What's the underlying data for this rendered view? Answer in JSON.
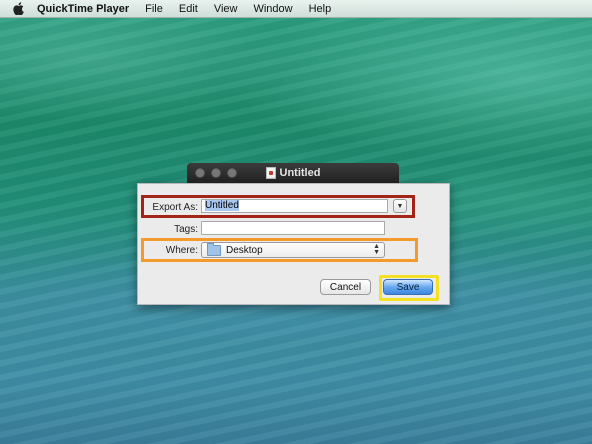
{
  "menubar": {
    "apple_icon": "apple-icon",
    "app_name": "QuickTime Player",
    "items": [
      "File",
      "Edit",
      "View",
      "Window",
      "Help"
    ]
  },
  "window": {
    "title": "Untitled",
    "doc_icon": "document-icon"
  },
  "sheet": {
    "export_as_label": "Export As:",
    "export_as_value": "Untitled",
    "tags_label": "Tags:",
    "tags_value": "",
    "where_label": "Where:",
    "where_value": "Desktop",
    "cancel_label": "Cancel",
    "save_label": "Save"
  },
  "annotations": {
    "export_highlight_color": "#a32418",
    "where_highlight_color": "#f29a2b",
    "save_highlight_color": "#f3e022"
  }
}
